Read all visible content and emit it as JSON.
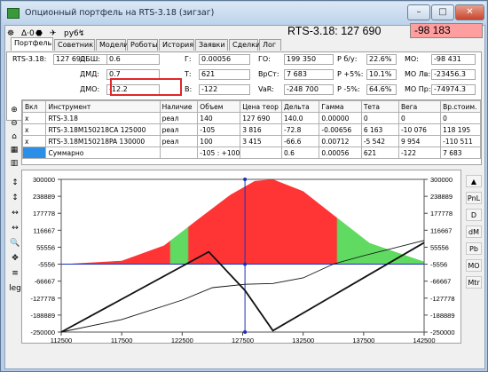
{
  "window": {
    "title": "Опционный портфель на RTS-3.18 (зигзаг)",
    "minimize": "–",
    "maximize": "□",
    "close": "✕"
  },
  "toolbar": {
    "items": [
      "☸",
      "Δ·0",
      "⬣",
      "✈",
      "ру6",
      "↯"
    ]
  },
  "header": {
    "instrument_price": "RTS-3.18: 127 690",
    "pnl": "-98 183"
  },
  "tabs": [
    "Портфель",
    "Советник",
    "Модели",
    "Роботы",
    "История",
    "Заявки",
    "Сделки",
    "Лог"
  ],
  "panel": {
    "underlying_label": "RTS-3.18:",
    "underlying_value": "127 690",
    "fields": [
      {
        "label": "ДБШ:",
        "value": "0.6"
      },
      {
        "label": "ДМД:",
        "value": "0.7"
      },
      {
        "label": "ДМО:",
        "value": "-12.2"
      },
      {
        "label": "Г:",
        "value": "0.00056"
      },
      {
        "label": "Т:",
        "value": "621"
      },
      {
        "label": "В:",
        "value": "-122"
      },
      {
        "label": "ГО:",
        "value": "199 350"
      },
      {
        "label": "ВрСт:",
        "value": "7 683"
      },
      {
        "label": "VaR:",
        "value": "-248 700"
      },
      {
        "label": "P б/у:",
        "value": "22.6%"
      },
      {
        "label": "P +5%:",
        "value": "10.1%"
      },
      {
        "label": "P -5%:",
        "value": "64.6%"
      },
      {
        "label": "МО:",
        "value": "-98 431"
      },
      {
        "label": "МО Лв:",
        "value": "-23456.3"
      },
      {
        "label": "МО Пр:",
        "value": "-74974.3"
      }
    ],
    "refresh_icon": "↻"
  },
  "table": {
    "headers": [
      "Вкл",
      "Инструмент",
      "Наличие",
      "Объем",
      "Цена теор",
      "Дельта",
      "Гамма",
      "Тета",
      "Вега",
      "Вр.стоим."
    ],
    "rows": [
      [
        "x",
        "RTS-3.18",
        "реал",
        "140",
        "127 690",
        "140.0",
        "0.00000",
        "0",
        "0",
        "0"
      ],
      [
        "x",
        "RTS-3.18M150218CA 125000",
        "реал",
        "-105",
        "3 816",
        "-72.8",
        "-0.00656",
        "6 163",
        "-10 076",
        "118 195"
      ],
      [
        "x",
        "RTS-3.18M150218PA 130000",
        "реал",
        "100",
        "3 415",
        "-66.6",
        "0.00712",
        "-5 542",
        "9 954",
        "-110 511"
      ],
      [
        "",
        "Суммарно",
        "",
        "-105 : +100",
        "",
        "0.6",
        "0.00056",
        "621",
        "-122",
        "7 683"
      ]
    ],
    "summary_color": "#2b8fe8"
  },
  "left_tools": {
    "top": [
      "⊕",
      "⊖",
      "⌂",
      "▦",
      "▥"
    ],
    "bottom": [
      "↕",
      "↕",
      "↔",
      "↔",
      "🔍",
      "✥",
      "≡",
      "leg"
    ]
  },
  "right_buttons": [
    "▲",
    "PnL",
    "D",
    "dM",
    "Pb",
    "MO",
    "Mtr"
  ],
  "chart_data": {
    "type": "line",
    "xlim": [
      112500,
      142500
    ],
    "ylim": [
      -250000,
      300000
    ],
    "x_ticks": [
      112500,
      117500,
      122500,
      127500,
      132500,
      137500,
      142500
    ],
    "y_ticks": [
      300000,
      238889,
      177778,
      116667,
      55556,
      -5556,
      -66667,
      -127778,
      -188889,
      -250000
    ],
    "x_tick_labels": [
      "112500",
      "117500",
      "122500",
      "127500",
      "132500",
      "137500",
      "142500"
    ],
    "y_tick_labels": [
      "300000",
      "238889",
      "177778",
      "116667",
      "55556",
      "-5556",
      "-66667",
      "-127778",
      "-188889",
      "-250000"
    ],
    "current_price": 127690,
    "zero_level": -5556,
    "colors": {
      "loss": "#ff2a2a",
      "profit": "#58d858",
      "line": "#111111",
      "crosshair": "#1f2fb8"
    },
    "series": [
      {
        "values_x": [
          112500,
          124700,
          127690,
          130000,
          142500
        ],
        "values_y": [
          -250000,
          39000,
          -100000,
          -245000,
          72000
        ]
      },
      {
        "values_x": [
          112500,
          117500,
          122500,
          125000,
          127690,
          130000,
          132500,
          135000,
          137500,
          142500
        ],
        "values_y": [
          -250000,
          -205000,
          -135000,
          -90000,
          -78000,
          -75000,
          -55000,
          -5000,
          25000,
          80000
        ]
      }
    ],
    "distribution": [
      {
        "x": 112500,
        "v": 0
      },
      {
        "x": 117500,
        "v": 0.04
      },
      {
        "x": 121000,
        "v": 0.22
      },
      {
        "x": 124000,
        "v": 0.55
      },
      {
        "x": 126500,
        "v": 0.82
      },
      {
        "x": 128500,
        "v": 0.98
      },
      {
        "x": 130000,
        "v": 1.0
      },
      {
        "x": 132500,
        "v": 0.86
      },
      {
        "x": 135000,
        "v": 0.58
      },
      {
        "x": 138000,
        "v": 0.25
      },
      {
        "x": 142500,
        "v": 0.03
      }
    ],
    "bands": [
      {
        "from": 112500,
        "to": 121500,
        "sign": "loss"
      },
      {
        "from": 121500,
        "to": 123000,
        "sign": "profit"
      },
      {
        "from": 123000,
        "to": 135300,
        "sign": "loss"
      },
      {
        "from": 135300,
        "to": 142500,
        "sign": "profit"
      }
    ]
  }
}
